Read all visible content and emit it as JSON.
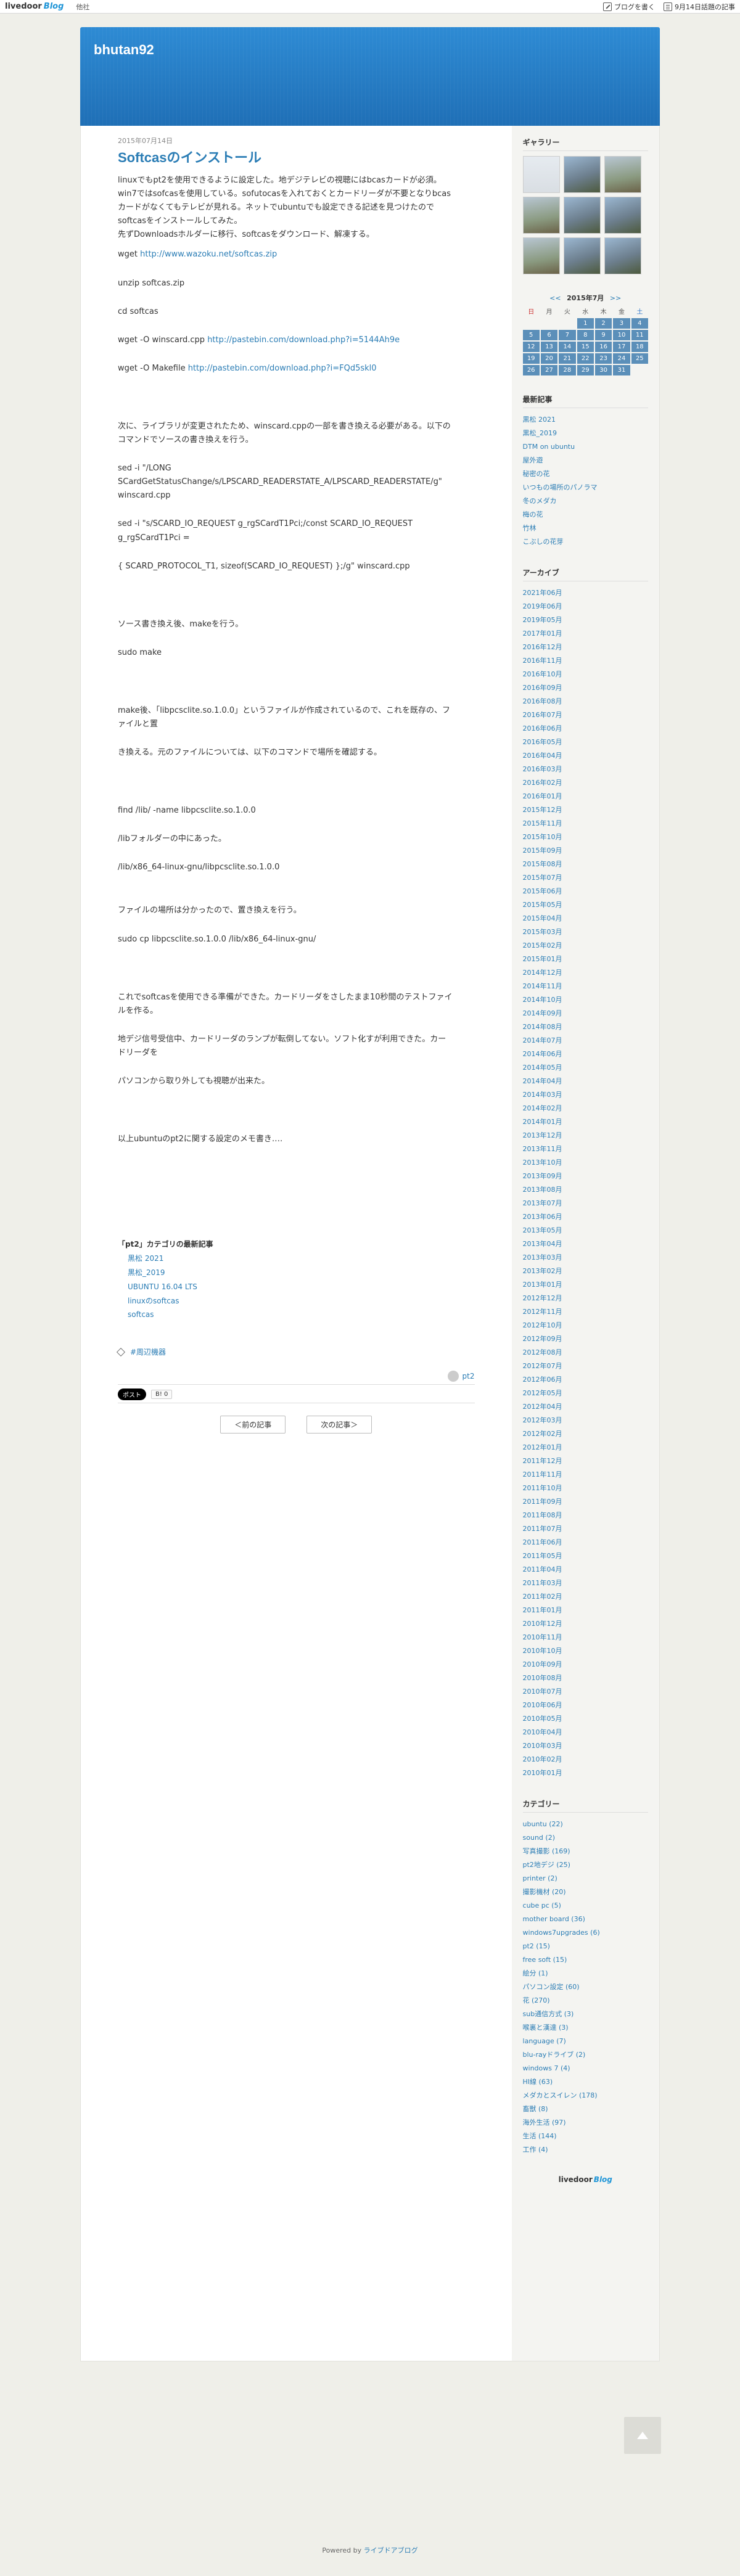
{
  "topbar": {
    "logo": "livedoor",
    "logo_blog": "Blog",
    "menu": "他社",
    "write_label": "ブログを書く",
    "today_label": "9月14日話題の記事"
  },
  "site": {
    "title": "bhutan92"
  },
  "post": {
    "date": "2015年07月14日",
    "title": "Softcasのインストール",
    "intro": [
      "linuxでもpt2を使用できるように設定した。地デジテレビの視聴にはbcasカードが必須。",
      "win7ではsofcasを使用している。sofutocasを入れておくとカードリーダが不要となりbcas",
      "カードがなくてもテレビが見れる。ネットでubuntuでも設定できる記述を見つけたので",
      "softcasをインストールしてみた。",
      "先ずDownloadsホルダーに移行、softcasをダウンロード、解凍する。"
    ],
    "wget1_prefix": "wget ",
    "wget1_link": "http://www.wazoku.net/softcas.zip",
    "unzip": "unzip softcas.zip",
    "cd": "cd softcas",
    "wget2_prefix": "wget -O winscard.cpp ",
    "wget2_link": "http://pastebin.com/download.php?i=5144Ah9e",
    "wget3_prefix": "wget -O Makefile ",
    "wget3_link": "http://pastebin.com/download.php?i=FQd5skl0",
    "next1": "次に、ライブラリが変更されたため、winscard.cppの一部を書き換える必要がある。以下の",
    "next2": "コマンドでソースの書き換えを行う。",
    "sed1a": "sed -i \"/LONG",
    "sed1b": "SCardGetStatusChange/s/LPSCARD_READERSTATE_A/LPSCARD_READERSTATE/g\"",
    "sed1c": "winscard.cpp",
    "sed2a": "sed -i \"s/SCARD_IO_REQUEST g_rgSCardT1Pci;/const SCARD_IO_REQUEST",
    "sed2b": "g_rgSCardT1Pci =",
    "sed2c": "{ SCARD_PROTOCOL_T1, sizeof(SCARD_IO_REQUEST) };/g\" winscard.cpp",
    "src_rewrite": "ソース書き換え後、makeを行う。",
    "sudo_make": "sudo make",
    "after_make1": "make後、「libpcsclite.so.1.0.0」というファイルが作成されているので、これを既存の、フ",
    "after_make2": "ァイルと置",
    "after_make3": "き換える。元のファイルについては、以下のコマンドで場所を確認する。",
    "find": "find /lib/ -name libpcsclite.so.1.0.0",
    "lib_found": "/libフォルダーの中にあった。",
    "lib_path": "/lib/x86_64-linux-gnu/libpcsclite.so.1.0.0",
    "place_found": "ファイルの場所は分かったので、置き換えを行う。",
    "sudo_cp": "sudo cp libpcsclite.so.1.0.0 /lib/x86_64-linux-gnu/",
    "done1": "これでsoftcasを使用できる準備ができた。カードリーダをさしたまま10秒間のテストファイ",
    "done2": "ルを作る。",
    "test1": "地デジ信号受信中、カードリーダのランプが転倒してない。ソフト化すが利用できた。カー",
    "test2": "ドリーダを",
    "test3": "パソコンから取り外しても視聴が出来た。",
    "memo": "以上ubuntuのpt2に関する設定のメモ書き‥‥"
  },
  "related": {
    "heading": "「pt2」カテゴリの最新記事",
    "items": [
      "黒松 2021",
      "黒松_2019",
      "UBUNTU 16.04 LTS",
      "linuxのsoftcas",
      "softcas"
    ]
  },
  "tag": "#周辺機器",
  "category_link": "pt2",
  "share": {
    "x_label": "ポスト",
    "hatena_label": "B! 0"
  },
  "pager": {
    "prev": "＜前の記事",
    "next": "次の記事＞"
  },
  "sidebar": {
    "gallery_title": "ギャラリー",
    "calendar": {
      "prev": "<<",
      "month": "2015年7月",
      "next": ">>",
      "days": [
        "日",
        "月",
        "火",
        "水",
        "木",
        "金",
        "土"
      ]
    },
    "recent_title": "最新記事",
    "recent": [
      "黒松 2021",
      "黒松_2019",
      "DTM on ubuntu",
      "屋外遊",
      "秘密の花",
      "いつもの場所のパノラマ",
      "冬のメダカ",
      "梅の花",
      "竹林",
      "こぶしの花芽"
    ],
    "archive_title": "アーカイブ",
    "archive": [
      "2021年06月",
      "2019年06月",
      "2019年05月",
      "2017年01月",
      "2016年12月",
      "2016年11月",
      "2016年10月",
      "2016年09月",
      "2016年08月",
      "2016年07月",
      "2016年06月",
      "2016年05月",
      "2016年04月",
      "2016年03月",
      "2016年02月",
      "2016年01月",
      "2015年12月",
      "2015年11月",
      "2015年10月",
      "2015年09月",
      "2015年08月",
      "2015年07月",
      "2015年06月",
      "2015年05月",
      "2015年04月",
      "2015年03月",
      "2015年02月",
      "2015年01月",
      "2014年12月",
      "2014年11月",
      "2014年10月",
      "2014年09月",
      "2014年08月",
      "2014年07月",
      "2014年06月",
      "2014年05月",
      "2014年04月",
      "2014年03月",
      "2014年02月",
      "2014年01月",
      "2013年12月",
      "2013年11月",
      "2013年10月",
      "2013年09月",
      "2013年08月",
      "2013年07月",
      "2013年06月",
      "2013年05月",
      "2013年04月",
      "2013年03月",
      "2013年02月",
      "2013年01月",
      "2012年12月",
      "2012年11月",
      "2012年10月",
      "2012年09月",
      "2012年08月",
      "2012年07月",
      "2012年06月",
      "2012年05月",
      "2012年04月",
      "2012年03月",
      "2012年02月",
      "2012年01月",
      "2011年12月",
      "2011年11月",
      "2011年10月",
      "2011年09月",
      "2011年08月",
      "2011年07月",
      "2011年06月",
      "2011年05月",
      "2011年04月",
      "2011年03月",
      "2011年02月",
      "2011年01月",
      "2010年12月",
      "2010年11月",
      "2010年10月",
      "2010年09月",
      "2010年08月",
      "2010年07月",
      "2010年06月",
      "2010年05月",
      "2010年04月",
      "2010年03月",
      "2010年02月",
      "2010年01月"
    ],
    "category_title": "カテゴリー",
    "categories": [
      "ubuntu (22)",
      "sound (2)",
      "写真撮影 (169)",
      "pt2地デジ (25)",
      "printer (2)",
      "撮影機材 (20)",
      "cube pc (5)",
      "mother board (36)",
      "windows7upgrades (6)",
      "pt2 (15)",
      "free soft (15)",
      "絵分 (1)",
      "パソコン設定 (60)",
      "花 (270)",
      "sub通信方式 (3)",
      "喉裏と漢達 (3)",
      "language (7)",
      "blu-rayドライブ (2)",
      "windows 7 (4)",
      "HI線 (63)",
      "メダカとスイレン (178)",
      "畜獣 (8)",
      "海外生活 (97)",
      "生活 (144)",
      "工作 (4)"
    ],
    "footer_logo": "livedoor",
    "footer_logo_blog": "Blog"
  },
  "footer": {
    "powered_prefix": "Powered by ",
    "powered_brand": "ライブドアブログ"
  }
}
